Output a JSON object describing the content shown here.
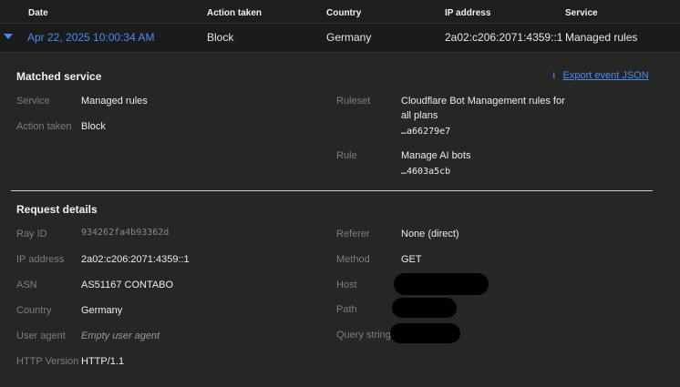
{
  "table": {
    "headers": [
      "Date",
      "Action taken",
      "Country",
      "IP address",
      "Service"
    ],
    "row": {
      "date": "Apr 22, 2025 10:00:34 AM",
      "action": "Block",
      "country": "Germany",
      "ip": "2a02:c206:2071:4359::1",
      "service": "Managed rules"
    }
  },
  "matched": {
    "title": "Matched service",
    "export_label": "Export event JSON",
    "service_label": "Service",
    "service_value": "Managed rules",
    "action_label": "Action taken",
    "action_value": "Block",
    "ruleset_label": "Ruleset",
    "ruleset_name_line1": "Cloudflare Bot Management rules for",
    "ruleset_name_line2": "all plans",
    "ruleset_id": "…a66279e7",
    "rule_label": "Rule",
    "rule_name": "Manage AI bots",
    "rule_id": "…4603a5cb"
  },
  "request": {
    "title": "Request details",
    "ray_label": "Ray ID",
    "ray_value": "934262fa4b93362d",
    "ip_label": "IP address",
    "ip_value": "2a02:c206:2071:4359::1",
    "asn_label": "ASN",
    "asn_value": "AS51167 CONTABO",
    "country_label": "Country",
    "country_value": "Germany",
    "ua_label": "User agent",
    "ua_value": "Empty user agent",
    "http_label": "HTTP Version",
    "http_value": "HTTP/1.1",
    "referer_label": "Referer",
    "referer_value": "None (direct)",
    "method_label": "Method",
    "method_value": "GET",
    "host_label": "Host",
    "path_label": "Path",
    "query_label": "Query string"
  },
  "colors": {
    "accent": "#4a8bf2",
    "panel": "#262626",
    "background": "#1b1b1b"
  }
}
